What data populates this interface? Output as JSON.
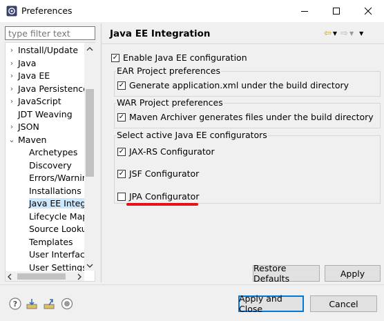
{
  "window": {
    "title": "Preferences"
  },
  "filter": {
    "placeholder": "type filter text"
  },
  "tree": [
    {
      "label": "Install/Update",
      "chevron": "›",
      "indent": 0
    },
    {
      "label": "Java",
      "chevron": "›",
      "indent": 0
    },
    {
      "label": "Java EE",
      "chevron": "›",
      "indent": 0
    },
    {
      "label": "Java Persistence",
      "chevron": "›",
      "indent": 0
    },
    {
      "label": "JavaScript",
      "chevron": "›",
      "indent": 0
    },
    {
      "label": "JDT Weaving",
      "chevron": "",
      "indent": 0
    },
    {
      "label": "JSON",
      "chevron": "›",
      "indent": 0
    },
    {
      "label": "Maven",
      "chevron": "⌄",
      "indent": 0
    },
    {
      "label": "Archetypes",
      "chevron": "",
      "indent": 1
    },
    {
      "label": "Discovery",
      "chevron": "",
      "indent": 1
    },
    {
      "label": "Errors/Warnings",
      "chevron": "",
      "indent": 1
    },
    {
      "label": "Installations",
      "chevron": "",
      "indent": 1
    },
    {
      "label": "Java EE Integration",
      "chevron": "",
      "indent": 1,
      "selected": true
    },
    {
      "label": "Lifecycle Mappings",
      "chevron": "",
      "indent": 1
    },
    {
      "label": "Source Lookup",
      "chevron": "",
      "indent": 1
    },
    {
      "label": "Templates",
      "chevron": "",
      "indent": 1
    },
    {
      "label": "User Interface",
      "chevron": "",
      "indent": 1
    },
    {
      "label": "User Settings",
      "chevron": "",
      "indent": 1
    }
  ],
  "page": {
    "title": "Java EE Integration",
    "enable": {
      "label": "Enable Java EE configuration",
      "checked": true
    },
    "ear": {
      "title": "EAR Project preferences",
      "option": {
        "label": "Generate application.xml under the build directory",
        "checked": true
      }
    },
    "war": {
      "title": "WAR Project preferences",
      "option": {
        "label": "Maven Archiver generates files under the build directory",
        "checked": true
      }
    },
    "configurators": {
      "title": "Select active Java EE configurators",
      "items": [
        {
          "label": "JAX-RS Configurator",
          "checked": true
        },
        {
          "label": "JSF Configurator",
          "checked": true
        },
        {
          "label": "JPA Configurator",
          "checked": false
        }
      ]
    },
    "restore_label": "Restore Defaults",
    "apply_label": "Apply"
  },
  "footer": {
    "apply_close_label": "Apply and Close",
    "cancel_label": "Cancel"
  },
  "colors": {
    "accent": "#0078d7",
    "highlight": "#e5121b",
    "selection": "#cce8ff"
  }
}
